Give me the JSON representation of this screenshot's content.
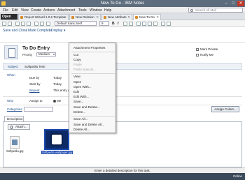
{
  "window": {
    "title": "New To Do - IBM Notes"
  },
  "menu": [
    "File",
    "Edit",
    "View",
    "Create",
    "Actions",
    "Attachment",
    "Tools",
    "Window",
    "Help"
  ],
  "search": {
    "placeholder": "Search All Mail"
  },
  "tabs": {
    "open_label": "Open",
    "items": [
      {
        "label": "Report Wizard 1.0.6 Template"
      },
      {
        "label": "New Relation"
      },
      {
        "label": "New Attribute"
      },
      {
        "label": "New To Do"
      }
    ]
  },
  "toolbar": {
    "font_name": "Default Sans Serif",
    "font_size": "9"
  },
  "actions": {
    "save_close": "Save and Close",
    "mark_complete": "Mark Complete",
    "display": "Display"
  },
  "header": {
    "title": "To Do Entry",
    "priority_label": "Priority",
    "priority_value": "Medium",
    "mark_private": "Mark Private",
    "notify_me": "Notify Me"
  },
  "form": {
    "subject_label": "Subject",
    "subject_value": "Softpedia Test!",
    "when_label": "When",
    "due_by_label": "Due by",
    "due_by_value": "Today",
    "start_by_label": "Start by",
    "start_by_value": "Today",
    "repeat_label": "Repeat",
    "repeat_value": "This entry d",
    "who_label": "Who",
    "assign_to_label": "Assign to",
    "assign_to_value": "Me",
    "categories_label": "Categories",
    "assign_colors": "Assign Colors..."
  },
  "description": {
    "tab_label": "Description",
    "attach_button": "Attach...",
    "attachments": [
      "Softpedia.jpg",
      "Softpedia wallpaper.jpg"
    ]
  },
  "context_menu": {
    "items": [
      {
        "label": "Attachment Properties",
        "enabled": true
      },
      {
        "label": "Cut",
        "enabled": true
      },
      {
        "label": "Copy",
        "enabled": true
      },
      {
        "label": "Paste",
        "enabled": false
      },
      {
        "label": "Paste Special...",
        "enabled": false
      },
      {
        "label": "View",
        "enabled": true
      },
      {
        "label": "Open",
        "enabled": true
      },
      {
        "label": "Open With...",
        "enabled": true
      },
      {
        "label": "Edit",
        "enabled": true
      },
      {
        "label": "Edit With...",
        "enabled": true
      },
      {
        "label": "Save...",
        "enabled": true
      },
      {
        "label": "Save and Delete...",
        "enabled": true
      },
      {
        "label": "Delete...",
        "enabled": true
      },
      {
        "label": "Save All...",
        "enabled": true
      },
      {
        "label": "Save and Delete All...",
        "enabled": true
      },
      {
        "label": "Delete All...",
        "enabled": true
      }
    ]
  },
  "status": {
    "message": "Enter a detailed description for this task.",
    "online": "Online"
  }
}
